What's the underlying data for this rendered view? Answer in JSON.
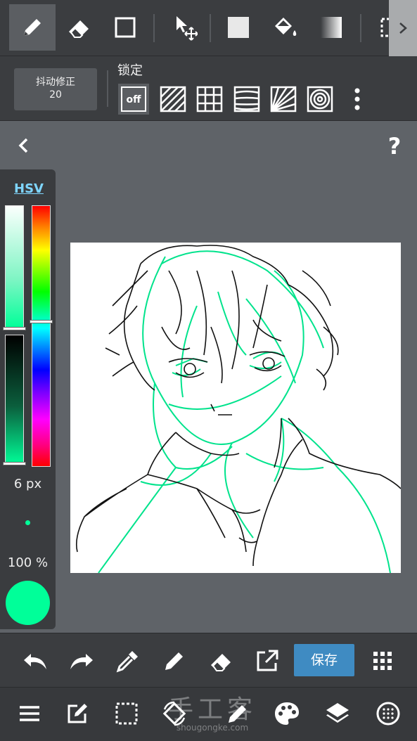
{
  "toolbar_top": {
    "tools": [
      "pen",
      "eraser",
      "shape",
      "move",
      "fill-rect",
      "bucket",
      "gradient",
      "select"
    ],
    "active_tool": "pen"
  },
  "toolbar_sub": {
    "stabilizer_label": "抖动修正",
    "stabilizer_value": "20",
    "lock_label": "锁定",
    "lock_off": "off"
  },
  "help_label": "?",
  "color_panel": {
    "mode_tab": "HSV",
    "brush_size": "6 px",
    "opacity": "100 %",
    "current_color": "#00ff99"
  },
  "action_bar": {
    "save_label": "保存"
  },
  "watermark": {
    "text": "手工客",
    "url": "shougongke.com"
  },
  "colors": {
    "accent": "#3f8bc2",
    "stroke": "#00e38c",
    "background": "#5f6368",
    "toolbar": "#3b3d40"
  }
}
